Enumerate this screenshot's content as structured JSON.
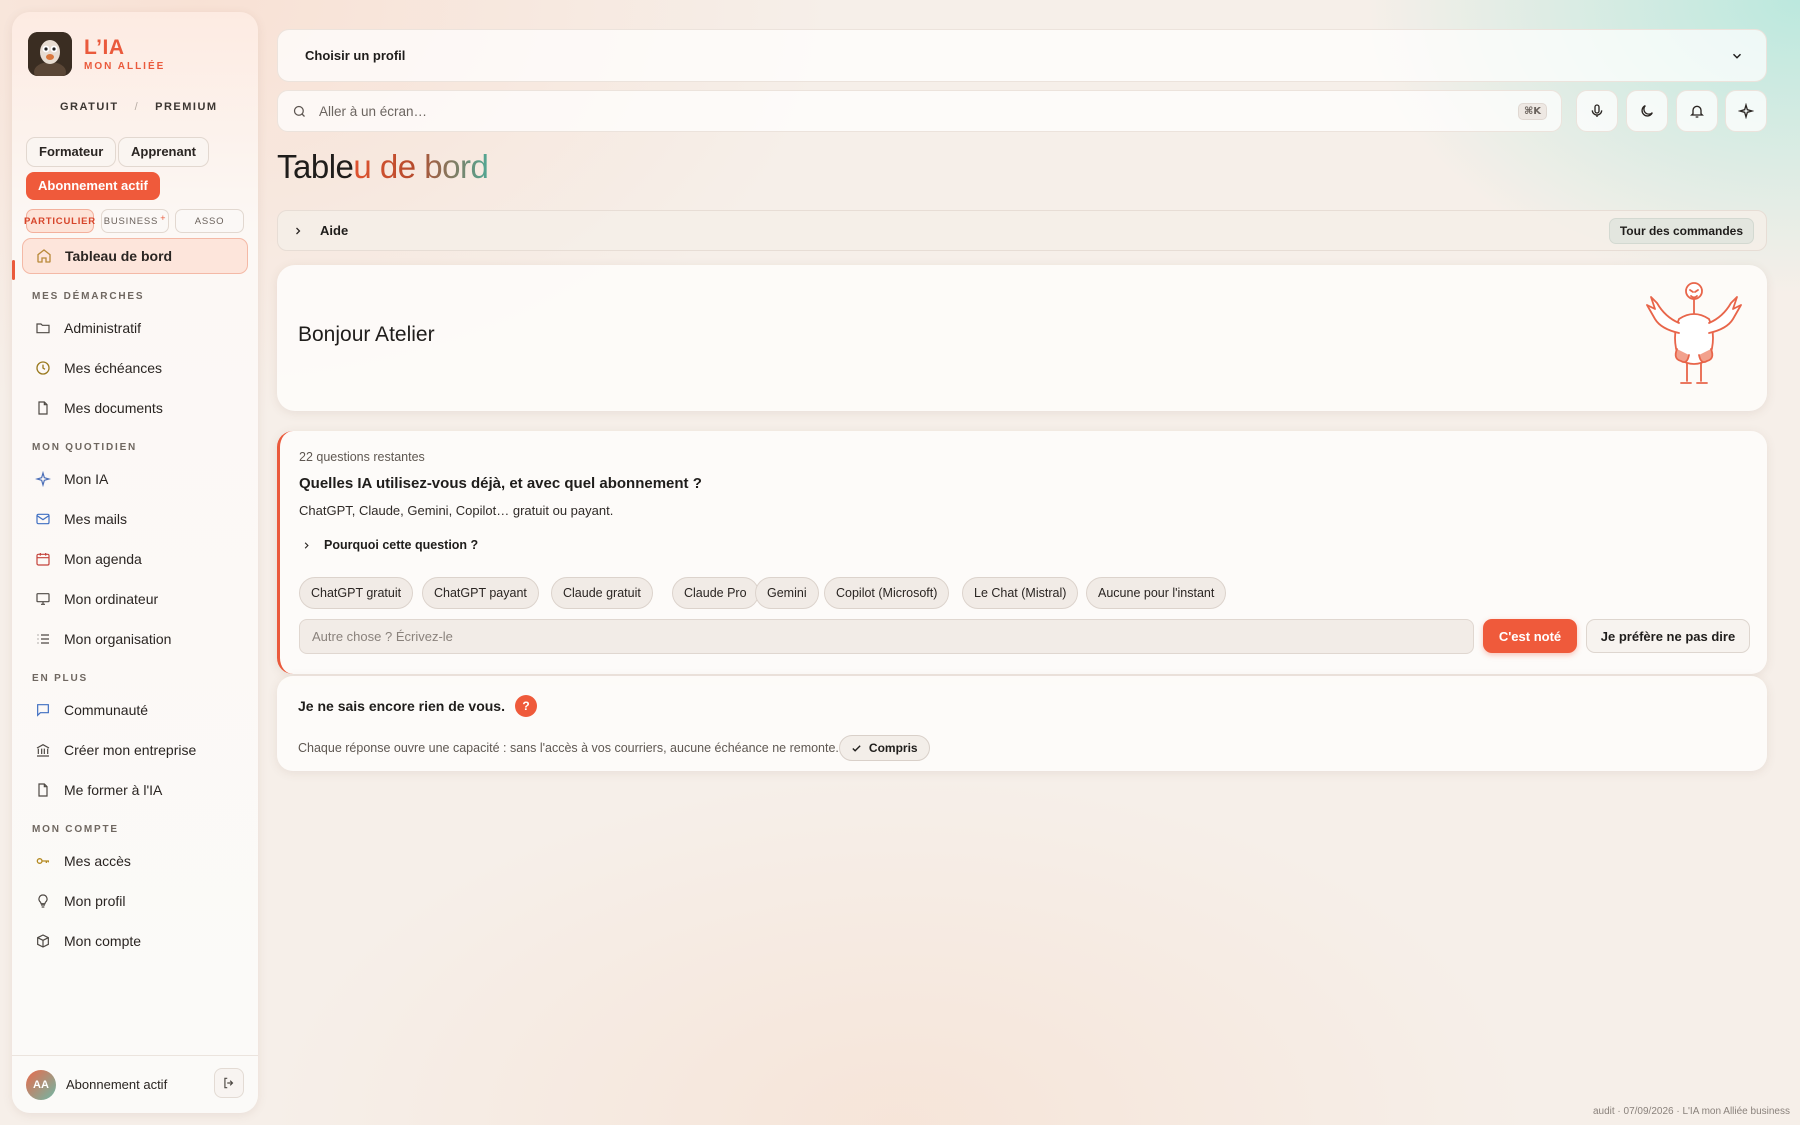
{
  "brand": {
    "title": "L’IA",
    "subtitle": "MON ALLIÉE"
  },
  "plans": {
    "free": "GRATUIT",
    "separator": "/",
    "premium": "PREMIUM"
  },
  "roles": {
    "trainer": "Formateur",
    "learner": "Apprenant"
  },
  "subscription_badge": "Abonnement actif",
  "segments": {
    "individual": "PARTICULIER",
    "business": "BUSINESS",
    "business_mark": "+",
    "association": "ASSO"
  },
  "nav": {
    "dashboard": "Tableau de bord",
    "sections": {
      "procedures": "MES DÉMARCHES",
      "daily": "MON QUOTIDIEN",
      "more": "EN PLUS",
      "account": "MON COMPTE"
    },
    "items": {
      "administrative": "Administratif",
      "deadlines": "Mes échéances",
      "documents": "Mes documents",
      "my_ai": "Mon IA",
      "mails": "Mes mails",
      "agenda": "Mon agenda",
      "computer": "Mon ordinateur",
      "organization": "Mon organisation",
      "community": "Communauté",
      "create_company": "Créer mon entreprise",
      "train_ai": "Me former à l'IA",
      "access": "Mes accès",
      "profile": "Mon profil",
      "account": "Mon compte"
    }
  },
  "sidebar_footer": {
    "initials": "AA",
    "label": "Abonnement actif"
  },
  "profile_select": {
    "label": "Choisir un profil"
  },
  "search": {
    "placeholder": "Aller à un écran…",
    "shortcut": "⌘K"
  },
  "page": {
    "title_plain": "Tableau",
    "title_gradient": "u de bord",
    "title_prefix": "Table"
  },
  "help": {
    "label": "Aide",
    "tour_button": "Tour des commandes"
  },
  "greeting": "Bonjour Atelier",
  "question": {
    "remaining": "22 questions restantes",
    "title": "Quelles IA utilisez-vous déjà, et avec quel abonnement ?",
    "subtitle": "ChatGPT, Claude, Gemini, Copilot… gratuit ou payant.",
    "why": "Pourquoi cette question ?",
    "options": [
      "ChatGPT gratuit",
      "ChatGPT payant",
      "Claude gratuit",
      "Claude Pro",
      "Gemini",
      "Copilot (Microsoft)",
      "Le Chat (Mistral)",
      "Aucune pour l'instant"
    ],
    "other_placeholder": "Autre chose ? Écrivez-le",
    "submit": "C'est noté",
    "skip": "Je préfère ne pas dire"
  },
  "info": {
    "title": "Je ne sais encore rien de vous.",
    "badge": "?",
    "text": "Chaque réponse ouvre une capacité : sans l'accès à vos courriers, aucune échéance ne remonte.",
    "button": "Compris"
  },
  "footer_note": "audit · 07/09/2026 · L'IA mon Alliée business",
  "colors": {
    "accent": "#ef5a3b",
    "teal": "#52a793"
  }
}
